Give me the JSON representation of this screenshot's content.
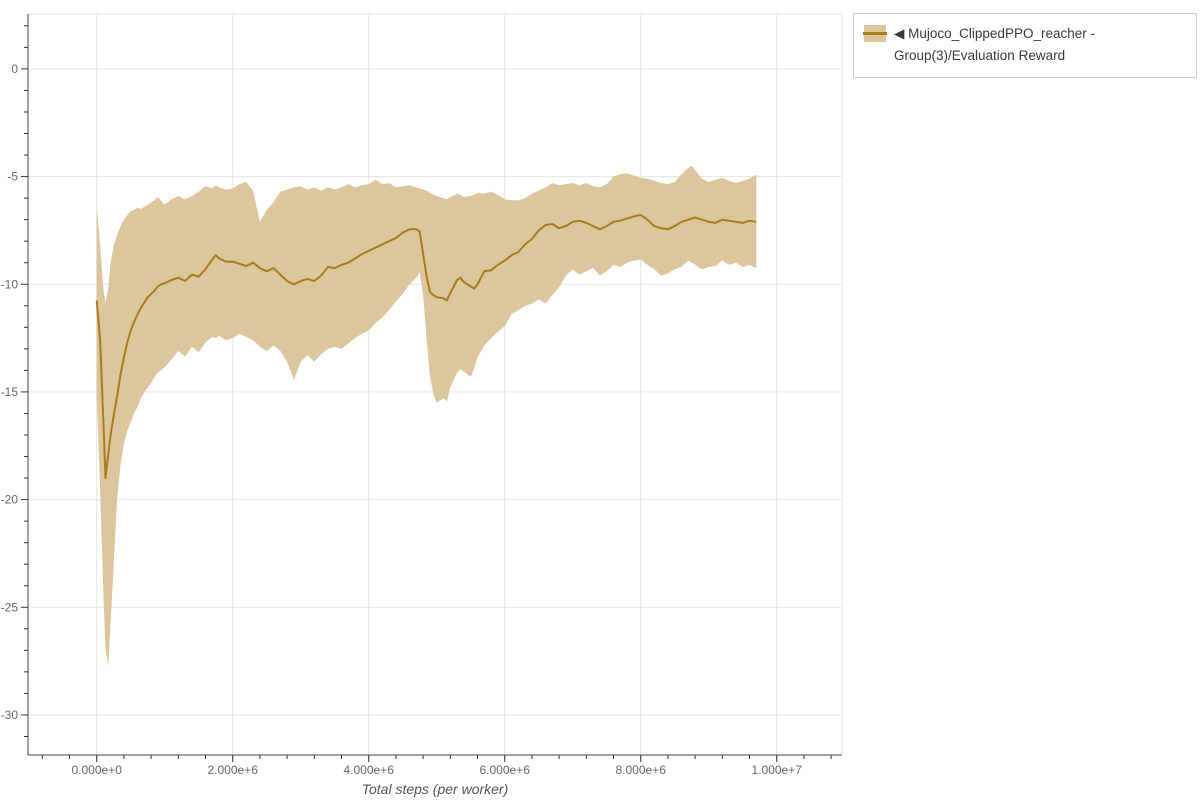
{
  "colors": {
    "line": "#a87d1a",
    "band": "#dcc69e",
    "grid": "#e5e5e5",
    "frame": "#e3e3e3",
    "axis_line": "#444444",
    "tick": "#333333",
    "tick_label": "#666666",
    "axis_title": "#555555",
    "legend_border": "#cbcbcb",
    "legend_text": "#3a3a3a"
  },
  "legend": {
    "items": [
      {
        "label": "◀ Mujoco_ClippedPPO_reacher - Group(3)/Evaluation Reward"
      }
    ]
  },
  "chart_data": {
    "type": "line",
    "title": "",
    "xlabel": "Total steps (per worker)",
    "ylabel": "",
    "grid": true,
    "legend_position": "right-outside",
    "x_range": [
      -1010000,
      10960000
    ],
    "y_range": [
      -31.86,
      2.55
    ],
    "x_major_ticks": [
      0,
      2000000,
      4000000,
      6000000,
      8000000,
      10000000
    ],
    "x_major_labels": [
      "0.000e+0",
      "2.000e+6",
      "4.000e+6",
      "6.000e+6",
      "8.000e+6",
      "1.000e+7"
    ],
    "x_minor_step": 400000,
    "y_major_ticks": [
      0,
      -5,
      -10,
      -15,
      -20,
      -25,
      -30
    ],
    "y_major_labels": [
      "0",
      "-5",
      "-10",
      "-15",
      "-20",
      "-25",
      "-30"
    ],
    "y_minor_step": 1,
    "series": [
      {
        "name": "Mujoco_ClippedPPO_reacher - Group(3)/Evaluation Reward",
        "x": [
          0,
          50000,
          100000,
          130000,
          170000,
          200000,
          250000,
          300000,
          350000,
          400000,
          450000,
          500000,
          550000,
          600000,
          650000,
          700000,
          750000,
          800000,
          850000,
          900000,
          950000,
          1000000,
          1100000,
          1200000,
          1300000,
          1400000,
          1500000,
          1600000,
          1700000,
          1750000,
          1800000,
          1900000,
          2000000,
          2100000,
          2200000,
          2300000,
          2400000,
          2500000,
          2600000,
          2700000,
          2800000,
          2900000,
          3000000,
          3100000,
          3200000,
          3300000,
          3400000,
          3500000,
          3600000,
          3700000,
          3800000,
          3900000,
          4000000,
          4100000,
          4200000,
          4300000,
          4400000,
          4500000,
          4600000,
          4700000,
          4750000,
          4800000,
          4850000,
          4900000,
          4950000,
          5000000,
          5100000,
          5150000,
          5200000,
          5300000,
          5350000,
          5400000,
          5500000,
          5550000,
          5600000,
          5700000,
          5800000,
          5900000,
          6000000,
          6100000,
          6200000,
          6300000,
          6400000,
          6500000,
          6600000,
          6700000,
          6800000,
          6900000,
          7000000,
          7100000,
          7200000,
          7300000,
          7400000,
          7500000,
          7600000,
          7700000,
          7800000,
          7900000,
          8000000,
          8100000,
          8200000,
          8300000,
          8400000,
          8500000,
          8600000,
          8700000,
          8750000,
          8800000,
          8900000,
          9000000,
          9100000,
          9200000,
          9300000,
          9400000,
          9500000,
          9600000,
          9700000
        ],
        "mean": [
          -10.75,
          -12.6,
          -16.5,
          -19.0,
          -17.9,
          -17.1,
          -16.1,
          -15.2,
          -14.2,
          -13.4,
          -12.7,
          -12.15,
          -11.75,
          -11.4,
          -11.1,
          -10.85,
          -10.6,
          -10.45,
          -10.3,
          -10.1,
          -10.0,
          -9.95,
          -9.8,
          -9.7,
          -9.85,
          -9.55,
          -9.65,
          -9.3,
          -8.85,
          -8.65,
          -8.8,
          -8.95,
          -8.95,
          -9.05,
          -9.15,
          -9.0,
          -9.25,
          -9.4,
          -9.25,
          -9.55,
          -9.85,
          -10.0,
          -9.85,
          -9.75,
          -9.85,
          -9.6,
          -9.2,
          -9.25,
          -9.1,
          -9.0,
          -8.8,
          -8.6,
          -8.45,
          -8.3,
          -8.15,
          -8.0,
          -7.85,
          -7.6,
          -7.45,
          -7.45,
          -7.55,
          -8.6,
          -9.6,
          -10.35,
          -10.5,
          -10.6,
          -10.65,
          -10.75,
          -10.4,
          -9.8,
          -9.7,
          -9.9,
          -10.1,
          -10.2,
          -10.0,
          -9.4,
          -9.35,
          -9.1,
          -8.9,
          -8.65,
          -8.5,
          -8.15,
          -7.9,
          -7.5,
          -7.25,
          -7.2,
          -7.4,
          -7.3,
          -7.1,
          -7.05,
          -7.15,
          -7.3,
          -7.45,
          -7.3,
          -7.1,
          -7.05,
          -6.95,
          -6.85,
          -6.78,
          -7.0,
          -7.3,
          -7.4,
          -7.45,
          -7.3,
          -7.1,
          -7.0,
          -6.95,
          -6.9,
          -7.0,
          -7.1,
          -7.15,
          -7.0,
          -7.05,
          -7.1,
          -7.15,
          -7.05,
          -7.1
        ],
        "upper": [
          -6.3,
          -8.2,
          -10.3,
          -10.85,
          -10.2,
          -9.1,
          -8.2,
          -7.7,
          -7.3,
          -7.0,
          -6.8,
          -6.6,
          -6.55,
          -6.45,
          -6.5,
          -6.4,
          -6.3,
          -6.2,
          -6.1,
          -5.95,
          -6.15,
          -6.3,
          -6.05,
          -5.9,
          -6.05,
          -5.9,
          -5.7,
          -5.45,
          -5.55,
          -5.4,
          -5.5,
          -5.6,
          -5.55,
          -5.35,
          -5.25,
          -5.65,
          -7.1,
          -6.55,
          -6.2,
          -5.7,
          -5.6,
          -5.5,
          -5.45,
          -5.6,
          -5.5,
          -5.65,
          -5.5,
          -5.6,
          -5.5,
          -5.35,
          -5.5,
          -5.4,
          -5.35,
          -5.15,
          -5.35,
          -5.3,
          -5.5,
          -5.45,
          -5.4,
          -5.5,
          -5.55,
          -5.6,
          -5.65,
          -5.75,
          -5.85,
          -5.9,
          -6.0,
          -6.05,
          -5.95,
          -5.8,
          -5.85,
          -5.95,
          -5.9,
          -5.85,
          -5.75,
          -5.8,
          -5.7,
          -5.85,
          -6.05,
          -6.1,
          -6.1,
          -6.0,
          -5.8,
          -5.65,
          -5.5,
          -5.3,
          -5.4,
          -5.35,
          -5.3,
          -5.4,
          -5.3,
          -5.45,
          -5.5,
          -5.35,
          -5.0,
          -4.9,
          -4.85,
          -4.95,
          -5.05,
          -5.1,
          -5.2,
          -5.3,
          -5.35,
          -5.25,
          -4.9,
          -4.6,
          -4.5,
          -4.7,
          -5.1,
          -5.25,
          -5.15,
          -5.05,
          -5.2,
          -5.3,
          -5.2,
          -5.1,
          -4.9
        ],
        "lower": [
          -15.2,
          -19.5,
          -24.5,
          -27.0,
          -27.7,
          -26.0,
          -23.0,
          -20.0,
          -18.4,
          -17.4,
          -16.8,
          -16.4,
          -16.0,
          -15.7,
          -15.3,
          -15.0,
          -14.8,
          -14.6,
          -14.3,
          -14.1,
          -14.0,
          -13.85,
          -13.5,
          -13.1,
          -13.35,
          -12.9,
          -13.15,
          -12.7,
          -12.45,
          -12.5,
          -12.4,
          -12.6,
          -12.5,
          -12.3,
          -12.45,
          -12.6,
          -12.9,
          -13.1,
          -12.85,
          -13.1,
          -13.6,
          -14.45,
          -13.6,
          -13.3,
          -13.6,
          -13.25,
          -13.0,
          -12.9,
          -13.0,
          -12.75,
          -12.5,
          -12.3,
          -12.15,
          -11.8,
          -11.55,
          -11.2,
          -10.8,
          -10.45,
          -10.0,
          -9.7,
          -9.45,
          -10.5,
          -12.5,
          -14.2,
          -15.1,
          -15.5,
          -15.3,
          -15.45,
          -14.8,
          -14.1,
          -13.95,
          -14.05,
          -14.3,
          -13.9,
          -13.4,
          -12.85,
          -12.5,
          -12.2,
          -11.95,
          -11.4,
          -11.2,
          -11.0,
          -10.9,
          -10.7,
          -10.9,
          -10.5,
          -10.15,
          -9.6,
          -9.3,
          -9.55,
          -9.4,
          -9.25,
          -9.6,
          -9.4,
          -9.1,
          -9.2,
          -9.0,
          -8.9,
          -8.85,
          -9.1,
          -9.3,
          -9.6,
          -9.5,
          -9.3,
          -9.2,
          -8.9,
          -9.0,
          -9.1,
          -9.3,
          -9.2,
          -9.15,
          -8.9,
          -9.1,
          -9.0,
          -9.2,
          -9.1,
          -9.25
        ]
      }
    ]
  }
}
